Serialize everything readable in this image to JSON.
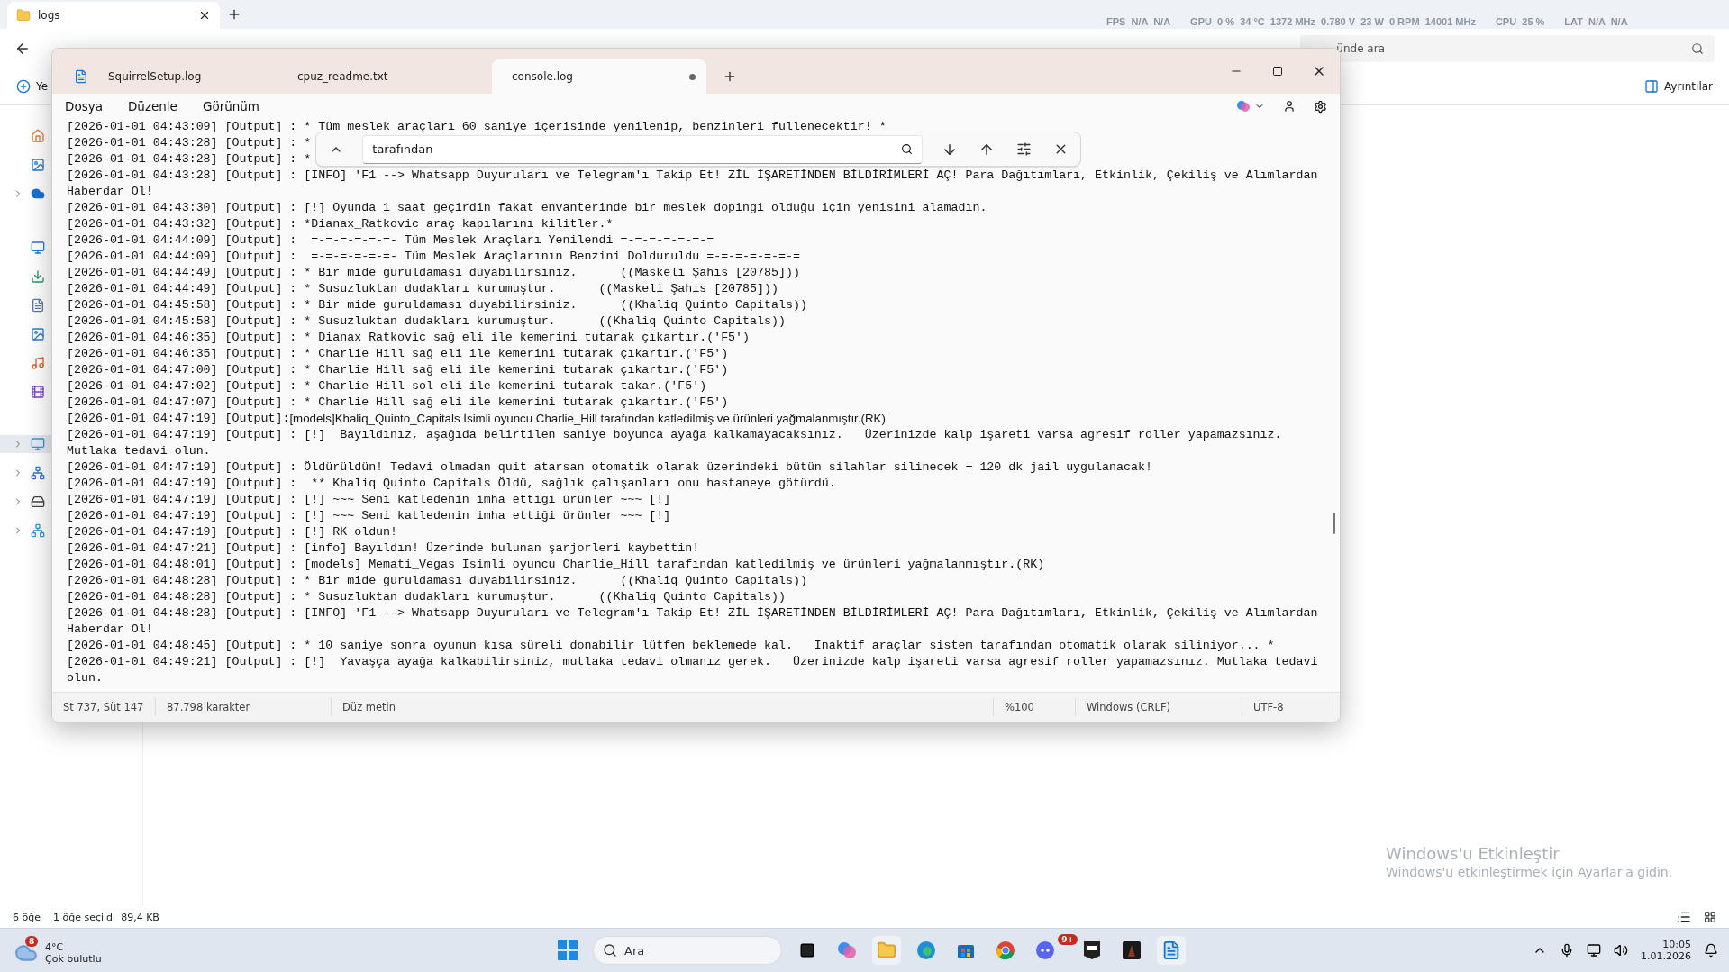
{
  "explorer": {
    "tab": "logs",
    "search_placeholder": "ünde ara",
    "new_button": "Ye",
    "details_button": "Ayrıntılar",
    "status": {
      "count": "6 öğe",
      "selected": "1 öğe seçildi",
      "size": "89,4 KB"
    }
  },
  "overlay_stats": [
    "FPS  N/A  N/A",
    "GPU  0 %  34 °C  1372 MHz  0.780 V  23 W  0 RPM  14001 MHz",
    "CPU  25 %",
    "LAT  N/A  N/A"
  ],
  "notepad": {
    "tabs": [
      {
        "label": "SquirrelSetup.log",
        "selected": false,
        "modified": false
      },
      {
        "label": "cpuz_readme.txt",
        "selected": false,
        "modified": false
      },
      {
        "label": "console.log",
        "selected": true,
        "modified": true
      }
    ],
    "menu": [
      "Dosya",
      "Düzenle",
      "Görünüm"
    ],
    "find": {
      "value": "tarafından"
    },
    "lines": [
      {
        "kind": "mono",
        "text": "[2026-01-01 04:43:09] [Output] : * Tüm meslek araçları 60 saniye içerisinde yenilenip, benzinleri fullenecektir! *"
      },
      {
        "kind": "mono",
        "text": "[2026-01-01 04:43:28] [Output] : *"
      },
      {
        "kind": "mono",
        "text": "[2026-01-01 04:43:28] [Output] : *"
      },
      {
        "kind": "mono",
        "text": "[2026-01-01 04:43:28] [Output] : [INFO] 'F1 --> Whatsapp Duyuruları ve Telegram'ı Takip Et! ZİL İŞARETİNDEN BİLDİRİMLERİ AÇ! Para Dağıtımları, Etkinlik, Çekiliş ve Alımlardan"
      },
      {
        "kind": "mono",
        "text": "Haberdar Ol!"
      },
      {
        "kind": "mono",
        "text": "[2026-01-01 04:43:30] [Output] : [!] Oyunda 1 saat geçirdin fakat envanterinde bir meslek dopingi olduğu için yenisini alamadın."
      },
      {
        "kind": "mono",
        "text": "[2026-01-01 04:43:32] [Output] : *Dianax_Ratkovic araç kapılarını kilitler.*"
      },
      {
        "kind": "mono",
        "text": "[2026-01-01 04:44:09] [Output] :  =-=-=-=-=-=- Tüm Meslek Araçları Yenilendi =-=-=-=-=-=-="
      },
      {
        "kind": "mono",
        "text": "[2026-01-01 04:44:09] [Output] :  =-=-=-=-=-=- Tüm Meslek Araçlarının Benzini Dolduruldu =-=-=-=-=-=-="
      },
      {
        "kind": "mono",
        "text": "[2026-01-01 04:44:49] [Output] : * Bir mide guruldaması duyabilirsiniz.      ((Maskeli Şahıs [20785]))"
      },
      {
        "kind": "mono",
        "text": "[2026-01-01 04:44:49] [Output] : * Susuzluktan dudakları kurumuştur.      ((Maskeli Şahıs [20785]))"
      },
      {
        "kind": "mono",
        "text": "[2026-01-01 04:45:58] [Output] : * Bir mide guruldaması duyabilirsiniz.      ((Khaliq Quinto Capitals))"
      },
      {
        "kind": "mono",
        "text": "[2026-01-01 04:45:58] [Output] : * Susuzluktan dudakları kurumuştur.      ((Khaliq Quinto Capitals))"
      },
      {
        "kind": "mono",
        "text": "[2026-01-01 04:46:35] [Output] : * Dianax Ratkovic sağ eli ile kemerini tutarak çıkartır.('F5')"
      },
      {
        "kind": "mono",
        "text": "[2026-01-01 04:46:35] [Output] : * Charlie Hill sağ eli ile kemerini tutarak çıkartır.('F5')"
      },
      {
        "kind": "mono",
        "text": "[2026-01-01 04:47:00] [Output] : * Charlie Hill sağ eli ile kemerini tutarak çıkartır.('F5')"
      },
      {
        "kind": "mono",
        "text": "[2026-01-01 04:47:02] [Output] : * Charlie Hill sol eli ile kemerini tutarak takar.('F5')"
      },
      {
        "kind": "mono",
        "text": "[2026-01-01 04:47:07] [Output] : * Charlie Hill sağ eli ile kemerini tutarak çıkartır.('F5')"
      },
      {
        "kind": "mixed",
        "prefix": "[2026-01-01 04:47:19] [Output]:",
        "text": "[models]Khaliq_Quinto_Capitals İsimli oyuncu Charlie_Hill tarafından katledilmiş ve ürünleri yağmalanmıştır.(RK)",
        "cursor": true
      },
      {
        "kind": "mono",
        "text": "[2026-01-01 04:47:19] [Output] : [!]  Bayıldınız, aşağıda belirtilen saniye boyunca ayağa kalkamayacaksınız.   Üzerinizde kalp işareti varsa agresif roller yapamazsınız."
      },
      {
        "kind": "mono",
        "text": "Mutlaka tedavi olun."
      },
      {
        "kind": "mono",
        "text": "[2026-01-01 04:47:19] [Output] : Öldürüldün! Tedavi olmadan quit atarsan otomatik olarak üzerindeki bütün silahlar silinecek + 120 dk jail uygulanacak!"
      },
      {
        "kind": "mono",
        "text": "[2026-01-01 04:47:19] [Output] :  ** Khaliq Quinto Capitals Öldü, sağlık çalışanları onu hastaneye götürdü."
      },
      {
        "kind": "mono",
        "text": "[2026-01-01 04:47:19] [Output] : [!] ~~~ Seni katledenin imha ettiği ürünler ~~~ [!]"
      },
      {
        "kind": "mono",
        "text": "[2026-01-01 04:47:19] [Output] : [!] ~~~ Seni katledenin imha ettiği ürünler ~~~ [!]"
      },
      {
        "kind": "mono",
        "text": "[2026-01-01 04:47:19] [Output] : [!] RK oldun!"
      },
      {
        "kind": "mono",
        "text": "[2026-01-01 04:47:21] [Output] : [info] Bayıldın! Üzerinde bulunan şarjorleri kaybettin!"
      },
      {
        "kind": "mono",
        "text": "[2026-01-01 04:48:01] [Output] : [models] Memati_Vegas İsimli oyuncu Charlie_Hill tarafından katledilmiş ve ürünleri yağmalanmıştır.(RK)"
      },
      {
        "kind": "mono",
        "text": "[2026-01-01 04:48:28] [Output] : * Bir mide guruldaması duyabilirsiniz.      ((Khaliq Quinto Capitals))"
      },
      {
        "kind": "mono",
        "text": "[2026-01-01 04:48:28] [Output] : * Susuzluktan dudakları kurumuştur.      ((Khaliq Quinto Capitals))"
      },
      {
        "kind": "mono",
        "text": "[2026-01-01 04:48:28] [Output] : [INFO] 'F1 --> Whatsapp Duyuruları ve Telegram'ı Takip Et! ZİL İŞARETİNDEN BİLDİRİMLERİ AÇ! Para Dağıtımları, Etkinlik, Çekiliş ve Alımlardan"
      },
      {
        "kind": "mono",
        "text": "Haberdar Ol!"
      },
      {
        "kind": "mono",
        "text": "[2026-01-01 04:48:45] [Output] : * 10 saniye sonra oyunun kısa süreli donabilir lütfen beklemede kal.   İnaktif araçlar sistem tarafından otomatik olarak siliniyor... *"
      },
      {
        "kind": "mono",
        "text": "[2026-01-01 04:49:21] [Output] : [!]  Yavaşça ayağa kalkabilirsiniz, mutlaka tedavi olmanız gerek.   Üzerinizde kalp işareti varsa agresif roller yapamazsınız. Mutlaka tedavi"
      },
      {
        "kind": "mono",
        "text": "olun."
      }
    ],
    "status": {
      "position": "St 737, Süt 147",
      "chars": "87.798 karakter",
      "type": "Düz metin",
      "zoom": "%100",
      "eol": "Windows (CRLF)",
      "encoding": "UTF-8"
    }
  },
  "watermark": {
    "title": "Windows'u Etkinleştir",
    "subtitle": "Windows'u etkinleştirmek için Ayarlar'a gidin."
  },
  "taskbar": {
    "weather": {
      "badge": "8",
      "temp": "4°C",
      "condition": "Çok bulutlu"
    },
    "search_placeholder": "Ara",
    "discord_badge": "9+",
    "time": "10:05",
    "date": "1.01.2026"
  }
}
